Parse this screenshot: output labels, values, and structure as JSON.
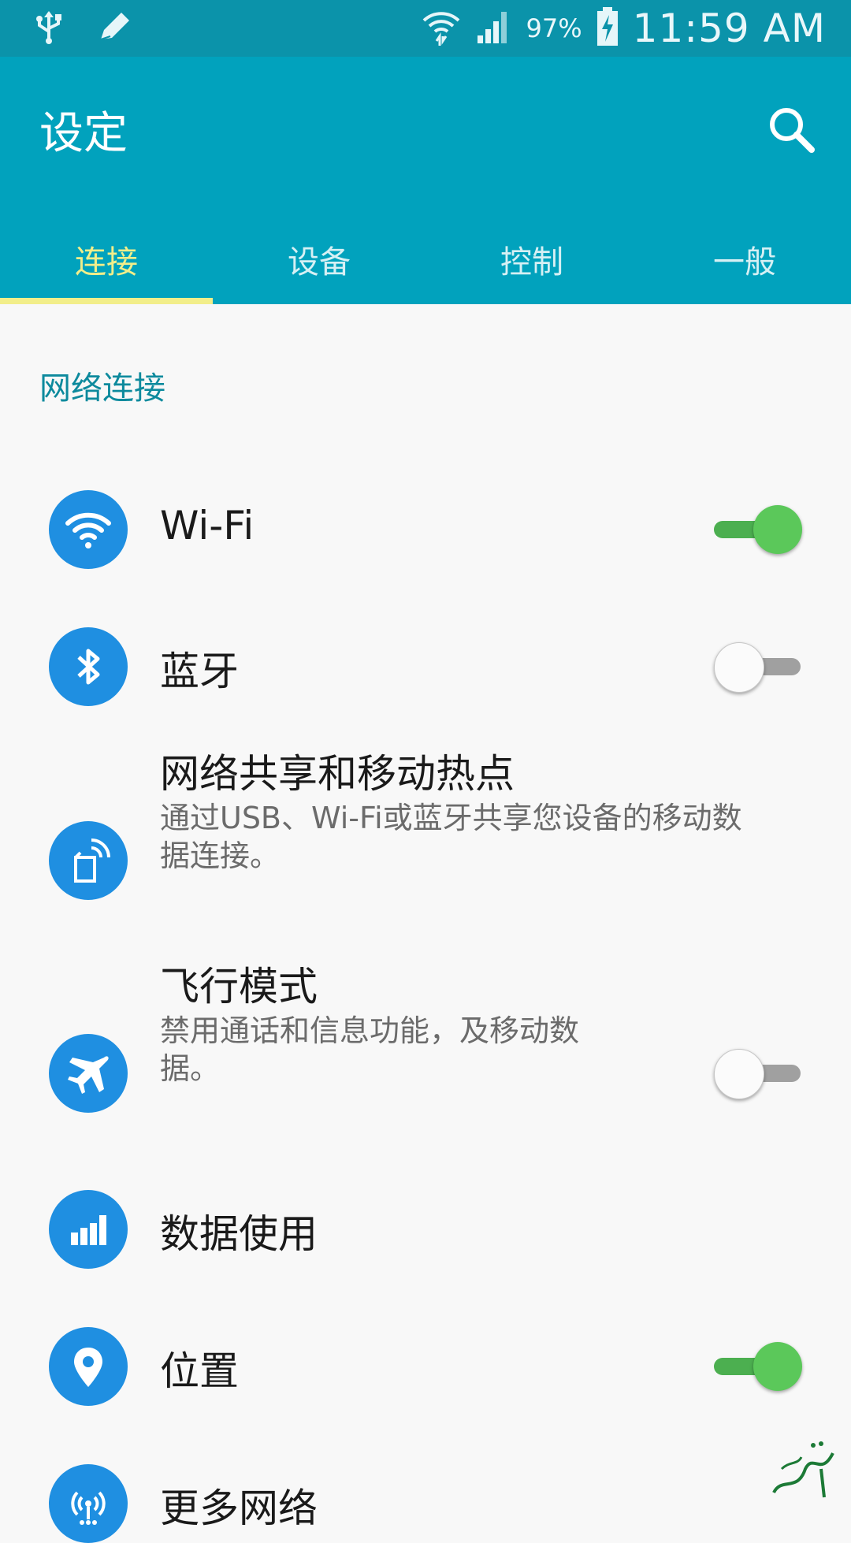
{
  "status_bar": {
    "battery_percent": "97%",
    "time": "11:59 AM",
    "icons": [
      "usb-icon",
      "edit-icon",
      "wifi-icon",
      "signal-icon",
      "battery-charging-icon"
    ]
  },
  "app_bar": {
    "title": "设定",
    "search_icon": "search-icon"
  },
  "tabs": [
    {
      "label": "连接",
      "active": true
    },
    {
      "label": "设备",
      "active": false
    },
    {
      "label": "控制",
      "active": false
    },
    {
      "label": "一般",
      "active": false
    }
  ],
  "section": {
    "header": "网络连接"
  },
  "items": [
    {
      "title": "Wi-Fi",
      "icon": "wifi-icon",
      "toggle": "on"
    },
    {
      "title": "蓝牙",
      "icon": "bluetooth-icon",
      "toggle": "off"
    },
    {
      "title": "网络共享和移动热点",
      "subtitle_line1": "通过USB、Wi-Fi或蓝牙共享您设备的移动数",
      "subtitle_line2": "据连接。",
      "icon": "hotspot-icon"
    },
    {
      "title": "飞行模式",
      "subtitle_line1": "禁用通话和信息功能，及移动数",
      "subtitle_line2": "据。",
      "icon": "airplane-icon",
      "toggle": "off"
    },
    {
      "title": "数据使用",
      "icon": "data-usage-icon"
    },
    {
      "title": "位置",
      "icon": "location-icon",
      "toggle": "on"
    },
    {
      "title": "更多网络",
      "icon": "more-networks-icon"
    }
  ],
  "colors": {
    "status_bar": "#0b93aa",
    "app_bar": "#01a2bd",
    "active_tab": "#f2ee8a",
    "icon_circle": "#1f8fe1",
    "switch_on": "#5bc85a",
    "section_header": "#0d8a9d"
  }
}
